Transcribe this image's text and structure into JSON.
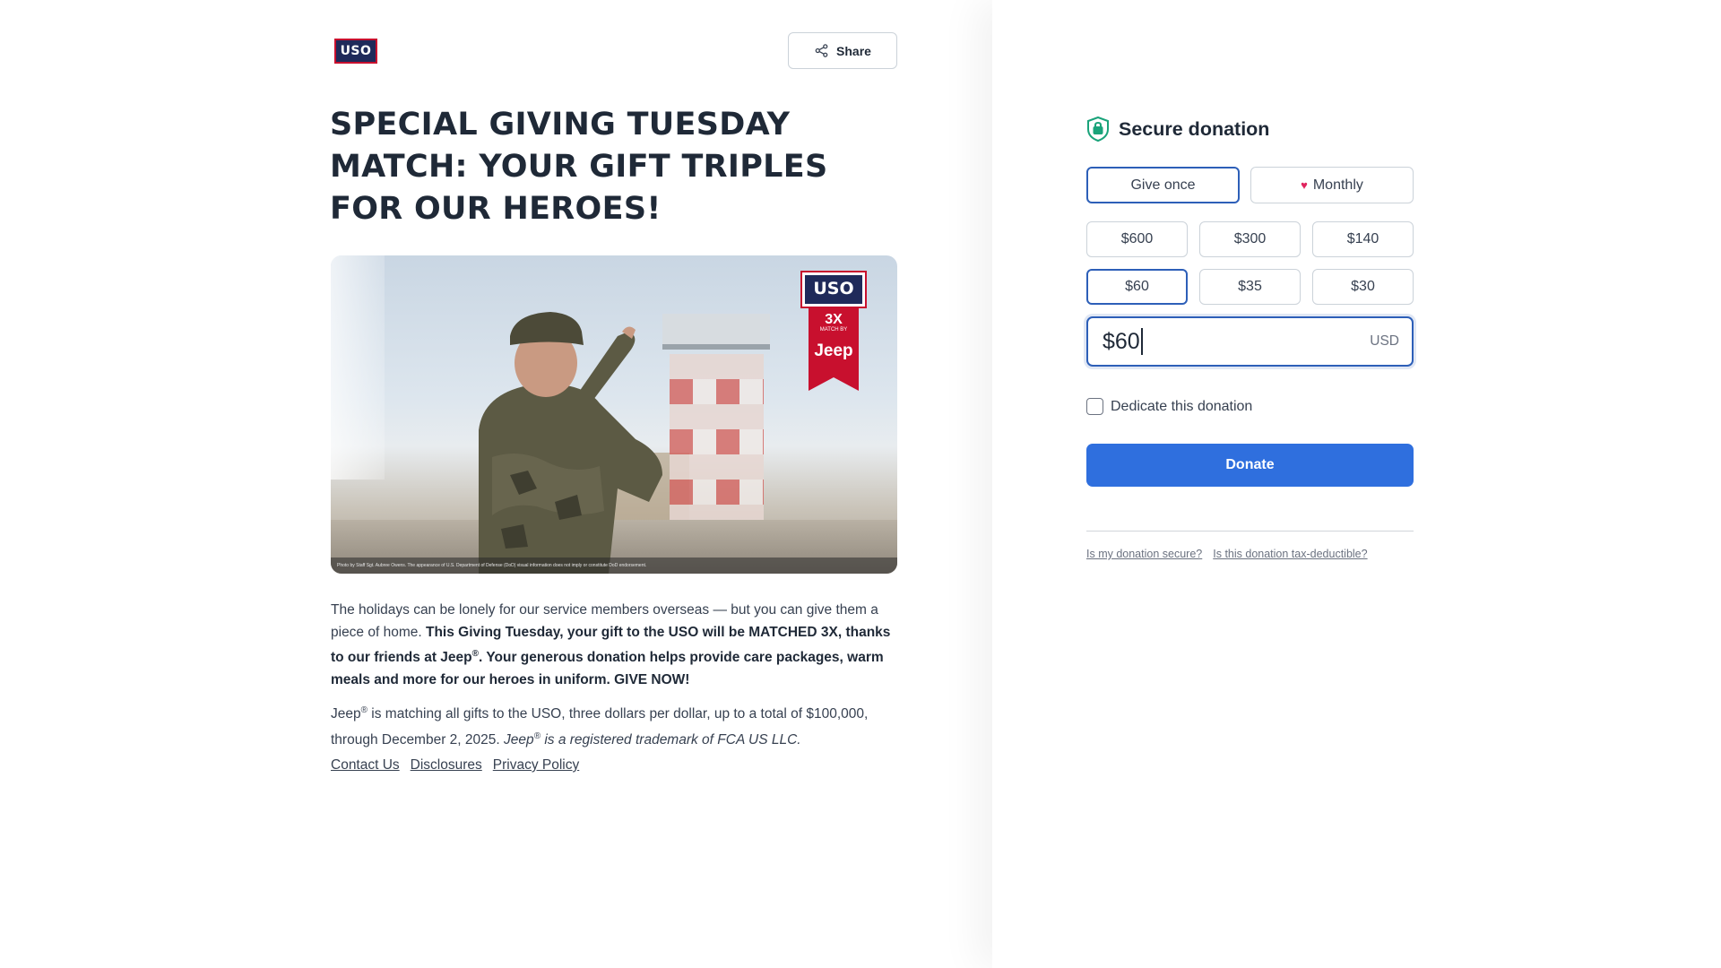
{
  "header": {
    "logo_text": "USO",
    "share_label": "Share"
  },
  "campaign": {
    "title": "SPECIAL GIVING TUESDAY MATCH: YOUR GIFT TRIPLES FOR OUR HEROES!",
    "image": {
      "badge_brand": "USO",
      "badge_match": "3X",
      "badge_match_sub": "MATCH BY",
      "badge_sponsor": "Jeep",
      "caption": "Photo by Staff Sgt. Aubree Owens. The appearance of U.S. Department of Defense (DoD) visual information does not imply or constitute DoD endorsement."
    },
    "para1_plain": "The holidays can be lonely for our service members overseas — but you can give them a piece of home. ",
    "para1_bold_a": "This Giving Tuesday, your gift to the USO will be MATCHED 3X, thanks to our friends at Jeep",
    "para1_bold_b": ". Your generous donation helps provide care packages, warm meals and more for our heroes in uniform. GIVE NOW!",
    "para2_a": "Jeep",
    "para2_b": " is matching all gifts to the USO, three dollars per dollar, up to a total of $100,000, through December 2, 2025. ",
    "para2_italic_a": "Jeep",
    "para2_italic_b": " is a registered trademark of FCA US LLC.",
    "registered_mark": "®"
  },
  "footer_links": [
    "Contact Us",
    "Disclosures",
    "Privacy Policy"
  ],
  "form": {
    "heading": "Secure donation",
    "frequency": {
      "once_label": "Give once",
      "monthly_label": "Monthly",
      "selected": "Give once"
    },
    "amounts": [
      "$600",
      "$300",
      "$140",
      "$60",
      "$35",
      "$30"
    ],
    "selected_amount": "$60",
    "amount_input_value": "$60",
    "currency": "USD",
    "dedicate_label": "Dedicate this donation",
    "dedicate_checked": false,
    "donate_label": "Donate",
    "help_links": [
      "Is my donation secure?",
      "Is this donation tax-deductible?"
    ]
  },
  "colors": {
    "accent": "#2f6fde",
    "selected_border": "#2d5fb8",
    "secure_icon": "#1aa37a",
    "heart": "#e0245e",
    "text": "#1f2937"
  },
  "icons": {
    "share": "share-icon",
    "secure": "shield-lock-icon",
    "monthly": "heart-icon"
  }
}
